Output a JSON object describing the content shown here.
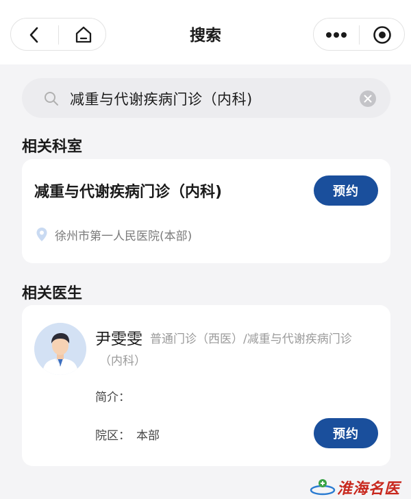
{
  "header": {
    "title": "搜索"
  },
  "search": {
    "value": "减重与代谢疾病门诊（内科)"
  },
  "sections": {
    "departments_title": "相关科室",
    "doctors_title": "相关医生"
  },
  "department": {
    "name": "减重与代谢疾病门诊（内科)",
    "hospital": "徐州市第一人民医院(本部)",
    "book_label": "预约"
  },
  "doctor": {
    "name": "尹雯雯",
    "dept_line1": "普通门诊（西医）/减重与代谢疾病门诊",
    "dept_line2": "（内科）",
    "intro_label": "简介：",
    "campus_label": "院区：",
    "campus_value": "本部",
    "book_label": "预约"
  },
  "watermark": {
    "text": "淮海名医网"
  },
  "colors": {
    "accent": "#1a4f9c",
    "background": "#f4f4f6",
    "card": "#ffffff"
  },
  "icons": [
    "back-arrow-icon",
    "home-icon",
    "more-dots-icon",
    "target-icon",
    "search-icon",
    "clear-icon",
    "location-pin-icon",
    "doctor-avatar"
  ]
}
